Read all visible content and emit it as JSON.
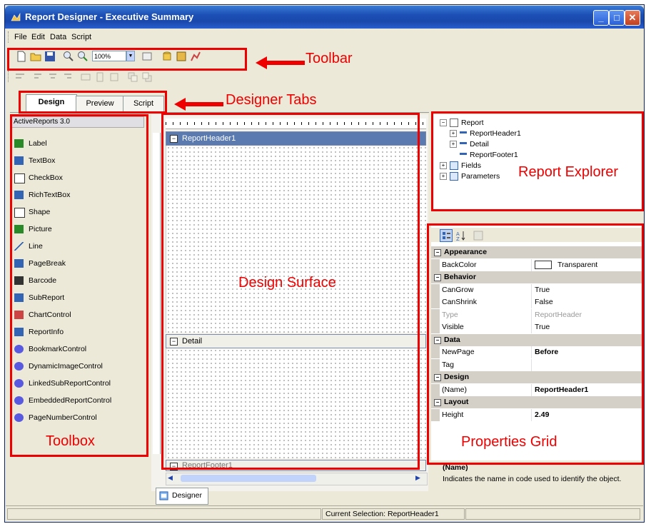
{
  "window": {
    "title": "Report Designer - Executive Summary"
  },
  "menu": [
    "File",
    "Edit",
    "Data",
    "Script"
  ],
  "toolbar": {
    "zoom_value": "100%"
  },
  "tabs": [
    "Design",
    "Preview",
    "Script"
  ],
  "bottom_tab": "Designer",
  "toolbox": {
    "header": "ActiveReports 3.0",
    "items": [
      {
        "label": "Label",
        "icon": "label-icon"
      },
      {
        "label": "TextBox",
        "icon": "textbox-icon"
      },
      {
        "label": "CheckBox",
        "icon": "checkbox-icon"
      },
      {
        "label": "RichTextBox",
        "icon": "richtextbox-icon"
      },
      {
        "label": "Shape",
        "icon": "shape-icon"
      },
      {
        "label": "Picture",
        "icon": "picture-icon"
      },
      {
        "label": "Line",
        "icon": "line-icon"
      },
      {
        "label": "PageBreak",
        "icon": "pagebreak-icon"
      },
      {
        "label": "Barcode",
        "icon": "barcode-icon"
      },
      {
        "label": "SubReport",
        "icon": "subreport-icon"
      },
      {
        "label": "ChartControl",
        "icon": "chart-icon"
      },
      {
        "label": "ReportInfo",
        "icon": "reportinfo-icon"
      },
      {
        "label": "BookmarkControl",
        "icon": "gear-icon"
      },
      {
        "label": "DynamicImageControl",
        "icon": "gear-icon"
      },
      {
        "label": "LinkedSubReportControl",
        "icon": "gear-icon"
      },
      {
        "label": "EmbeddedReportControl",
        "icon": "gear-icon"
      },
      {
        "label": "PageNumberControl",
        "icon": "gear-icon"
      }
    ]
  },
  "surface": {
    "bands": [
      "ReportHeader1",
      "Detail",
      "ReportFooter1"
    ]
  },
  "explorer": {
    "root": "Report",
    "children": [
      "ReportHeader1",
      "Detail",
      "ReportFooter1"
    ],
    "other": [
      "Fields",
      "Parameters"
    ]
  },
  "properties": {
    "rows": [
      {
        "cat": true,
        "name": "Appearance"
      },
      {
        "name": "BackColor",
        "value": "Transparent",
        "swatch": true
      },
      {
        "cat": true,
        "name": "Behavior"
      },
      {
        "name": "CanGrow",
        "value": "True"
      },
      {
        "name": "CanShrink",
        "value": "False"
      },
      {
        "name": "Type",
        "value": "ReportHeader",
        "disabled": true
      },
      {
        "name": "Visible",
        "value": "True"
      },
      {
        "cat": true,
        "name": "Data"
      },
      {
        "name": "NewPage",
        "value": "Before",
        "bold": true
      },
      {
        "name": "Tag",
        "value": ""
      },
      {
        "cat": true,
        "name": "Design"
      },
      {
        "name": "(Name)",
        "value": "ReportHeader1",
        "bold": true
      },
      {
        "cat": true,
        "name": "Layout"
      },
      {
        "name": "Height",
        "value": "2.49",
        "bold": true
      }
    ],
    "desc_title": "(Name)",
    "desc_text": "Indicates the name in code used to identify the object."
  },
  "status": {
    "selection": "Current Selection: ReportHeader1"
  },
  "annotations": {
    "toolbar": "Toolbar",
    "designer_tabs": "Designer Tabs",
    "report_explorer": "Report Explorer",
    "design_surface": "Design Surface",
    "toolbox": "Toolbox",
    "properties_grid": "Properties Grid"
  },
  "colors": {
    "annotation": "#e00000",
    "titlebar": "#1c4fb5",
    "band_header": "#5a7ab0"
  }
}
